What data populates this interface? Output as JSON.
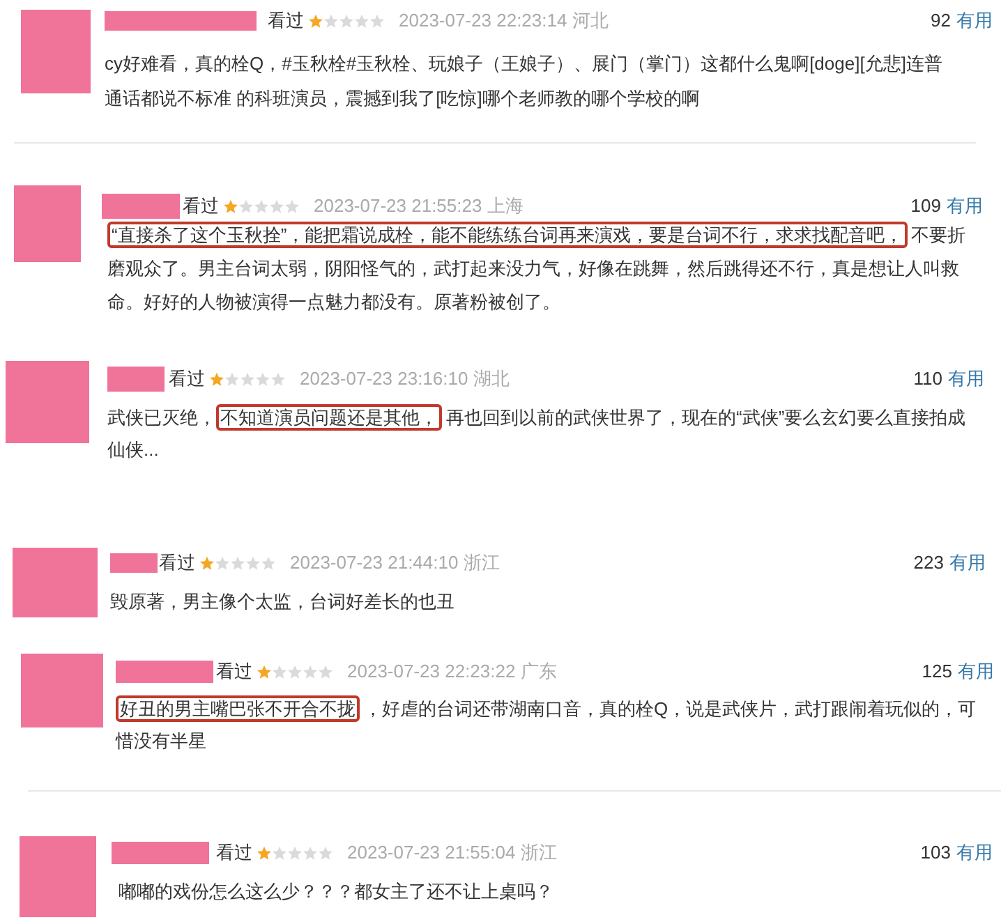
{
  "reviews": [
    {
      "watched_label": "看过",
      "stars": 1,
      "time": "2023-07-23 22:23:14",
      "location": "河北",
      "useful_count": "92",
      "useful_label": "有用",
      "segments": [
        {
          "text": "cy好难看，真的栓Q，#玉秋栓#玉秋栓、玩娘子（王娘子）、展门（掌门）这都什么鬼啊[doge][允悲]连普通话都说不标准 的科班演员，震撼到我了[吃惊]哪个老师教的哪个学校的啊",
          "highlighted": false
        }
      ],
      "divider_below": true
    },
    {
      "watched_label": "看过",
      "stars": 1,
      "time": "2023-07-23 21:55:23",
      "location": "上海",
      "useful_count": "109",
      "useful_label": "有用",
      "segments": [
        {
          "text": "“直接杀了这个玉秋拴”，能把霜说成栓，能不能练练台词再来演戏，要是台词不行，求求找配音吧，",
          "highlighted": true
        },
        {
          "text": "不要折磨观众了。男主台词太弱，阴阳怪气的，武打起来没力气，好像在跳舞，然后跳得还不行，真是想让人叫救命。好好的人物被演得一点魅力都没有。原著粉被创了。",
          "highlighted": false
        }
      ],
      "divider_below": false
    },
    {
      "watched_label": "看过",
      "stars": 1,
      "time": "2023-07-23 23:16:10",
      "location": "湖北",
      "useful_count": "110",
      "useful_label": "有用",
      "segments": [
        {
          "text": "武侠已灭绝，",
          "highlighted": false
        },
        {
          "text": "不知道演员问题还是其他，",
          "highlighted": true
        },
        {
          "text": "再也回到以前的武侠世界了，现在的“武侠”要么玄幻要么直接拍成仙侠...",
          "highlighted": false
        }
      ],
      "divider_below": false
    },
    {
      "watched_label": "看过",
      "stars": 1,
      "time": "2023-07-23 21:44:10",
      "location": "浙江",
      "useful_count": "223",
      "useful_label": "有用",
      "segments": [
        {
          "text": "毁原著，男主像个太监，台词好差长的也丑",
          "highlighted": false
        }
      ],
      "divider_below": false
    },
    {
      "watched_label": "看过",
      "stars": 1,
      "time": "2023-07-23 22:23:22",
      "location": "广东",
      "useful_count": "125",
      "useful_label": "有用",
      "segments": [
        {
          "text": "好丑的男主嘴巴张不开合不拢",
          "highlighted": true
        },
        {
          "text": "，好虐的台词还带湖南口音，真的栓Q，说是武侠片，武打跟闹着玩似的，可惜没有半星",
          "highlighted": false
        }
      ],
      "divider_below": true
    },
    {
      "watched_label": "看过",
      "stars": 1,
      "time": "2023-07-23 21:55:04",
      "location": "浙江",
      "useful_count": "103",
      "useful_label": "有用",
      "segments": [
        {
          "text": "嘟嘟的戏份怎么这么少？？？都女主了还不让上桌吗？",
          "highlighted": false
        }
      ],
      "divider_below": false
    }
  ]
}
